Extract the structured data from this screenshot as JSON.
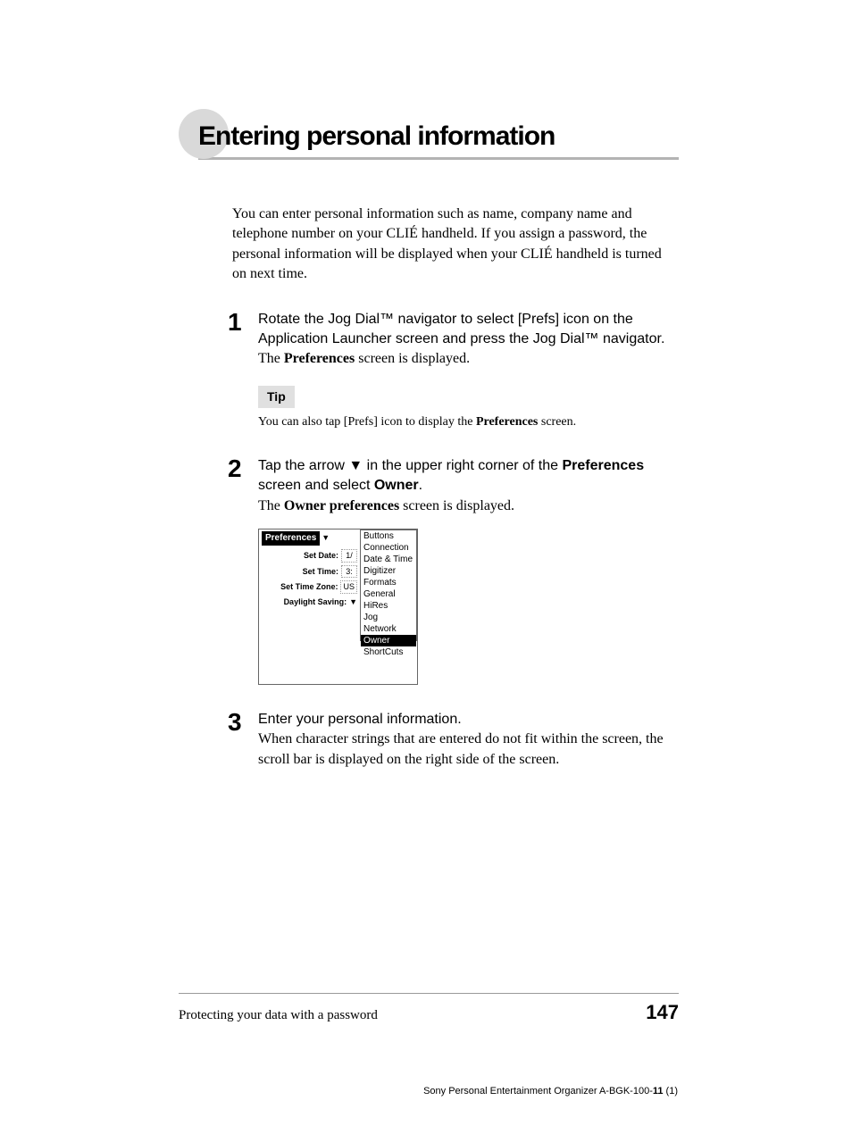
{
  "heading": "Entering personal information",
  "intro": "You can enter personal information such as name, company name and telephone number on your CLIÉ handheld. If you assign a password, the personal information will be displayed when your CLIÉ handheld is turned on next time.",
  "steps": [
    {
      "num": "1",
      "main_html": "Rotate the Jog Dial™ navigator to select [Prefs] icon on the Application Launcher screen and press the Jog Dial™ navigator.",
      "sub_prefix": "The ",
      "sub_bold": "Preferences",
      "sub_suffix": " screen is displayed.",
      "tip_label": "Tip",
      "tip_prefix": "You can also tap [Prefs] icon to display the ",
      "tip_bold": "Preferences",
      "tip_suffix": " screen."
    },
    {
      "num": "2",
      "main_before": "Tap the arrow ",
      "main_arrow": "▼",
      "main_mid": " in the upper right corner of the ",
      "main_bold1": "Preferences",
      "main_mid2": " screen and select ",
      "main_bold2": "Owner",
      "main_after": ".",
      "sub_prefix": "The ",
      "sub_bold": "Owner preferences",
      "sub_suffix": " screen is displayed."
    },
    {
      "num": "3",
      "main_html": "Enter your personal information.",
      "sub_full": "When character strings that are entered do not fit within the screen, the scroll bar is displayed on the right side of the screen."
    }
  ],
  "device": {
    "title": "Preferences",
    "rows": {
      "date_label": "Set Date:",
      "date_val": "1/",
      "time_label": "Set Time:",
      "time_val": "3:",
      "zone_label": "Set Time Zone:",
      "zone_val": "US",
      "dst_label": "Daylight Saving:",
      "dst_val": "▼"
    },
    "menu": [
      "Buttons",
      "Connection",
      "Date & Time",
      "Digitizer",
      "Formats",
      "General",
      "HiRes",
      "Jog",
      "Network",
      "Owner",
      "ShortCuts"
    ],
    "menu_selected": "Owner"
  },
  "footer": {
    "left": "Protecting your data with a password",
    "page": "147",
    "tiny_prefix": "Sony Personal Entertainment Organizer  A-BGK-100-",
    "tiny_bold": "11",
    "tiny_suffix": " (1)"
  }
}
